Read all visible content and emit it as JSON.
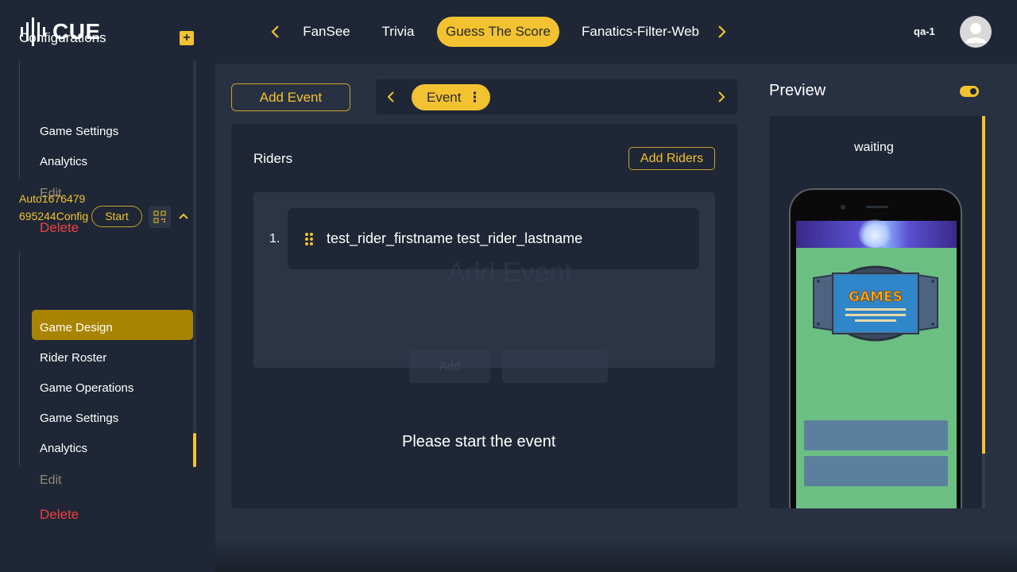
{
  "header": {
    "logo_text": "CUE",
    "tabs": [
      {
        "label": "FanSee",
        "active": false
      },
      {
        "label": "Trivia",
        "active": false
      },
      {
        "label": "Guess The Score",
        "active": true
      },
      {
        "label": "Fanatics-Filter-Web",
        "active": false
      }
    ],
    "user_label": "qa-1"
  },
  "sidebar": {
    "title": "Configurations",
    "add_symbol": "+",
    "group1_items": [
      {
        "label": "Game Settings"
      },
      {
        "label": "Analytics"
      },
      {
        "label": "Edit"
      },
      {
        "label": "Delete"
      }
    ],
    "config": {
      "name": "Auto1676479695244Config",
      "start_label": "Start"
    },
    "group2_items": [
      {
        "label": "Game Design"
      },
      {
        "label": "Rider Roster"
      },
      {
        "label": "Game Operations",
        "active": true
      },
      {
        "label": "Game Settings"
      },
      {
        "label": "Analytics"
      },
      {
        "label": "Edit"
      },
      {
        "label": "Delete"
      }
    ]
  },
  "main": {
    "add_event_label": "Add Event",
    "event_pill_label": "Event",
    "kebab": "⋮",
    "riders_title": "Riders",
    "add_riders_label": "Add Riders",
    "riders": [
      {
        "number": "1.",
        "name": "test_rider_firstname test_rider_lastname"
      }
    ],
    "ghost_modal_title": "Add Event",
    "ghost_button_label": "Add",
    "start_message": "Please start the event"
  },
  "preview": {
    "title": "Preview",
    "toggle_on": true,
    "status": "waiting",
    "badge_title": "GAMES"
  },
  "colors": {
    "accent": "#f2c230",
    "background": "#1f2736",
    "panel": "#283142",
    "delete": "#ef3f3f",
    "phone_screen": "#6bbf82"
  }
}
